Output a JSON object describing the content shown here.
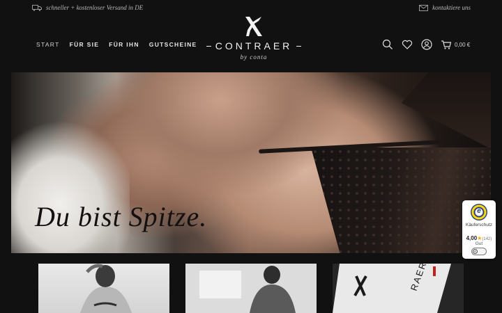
{
  "topbar": {
    "shipping_text": "schneller + kostenloser Versand in DE",
    "shipping_icon": "truck-icon",
    "contact_text": "kontaktiere uns",
    "contact_icon": "envelope-icon"
  },
  "nav": {
    "items": [
      {
        "label": "START"
      },
      {
        "label": "FÜR SIE"
      },
      {
        "label": "FÜR IHN"
      },
      {
        "label": "GUTSCHEINE"
      }
    ]
  },
  "logo": {
    "brand": "CONTRAER",
    "tagline": "by conta",
    "icon": "crossed-x-logo-icon"
  },
  "header_icons": {
    "search": "search-icon",
    "wishlist": "heart-icon",
    "account": "user-icon",
    "cart": "cart-icon",
    "cart_total": "0,00 €"
  },
  "hero": {
    "heading": "Du bist Spitze."
  },
  "tiles": [
    {
      "name": "women-product-tile"
    },
    {
      "name": "men-product-tile"
    },
    {
      "name": "brand-label-tile"
    }
  ],
  "trust_badge": {
    "seal_letter": "e",
    "label": "Käuferschutz",
    "rating": "4,00",
    "star": "★",
    "count": "(142)",
    "grade": "Gut",
    "corner": "…",
    "toggle_letter": "e"
  },
  "colors": {
    "background": "#111111",
    "text_light": "#e6e6e6",
    "star": "#f0a500",
    "seal_blue": "#2a3f7a",
    "seal_yellow": "#ffdc0f"
  }
}
